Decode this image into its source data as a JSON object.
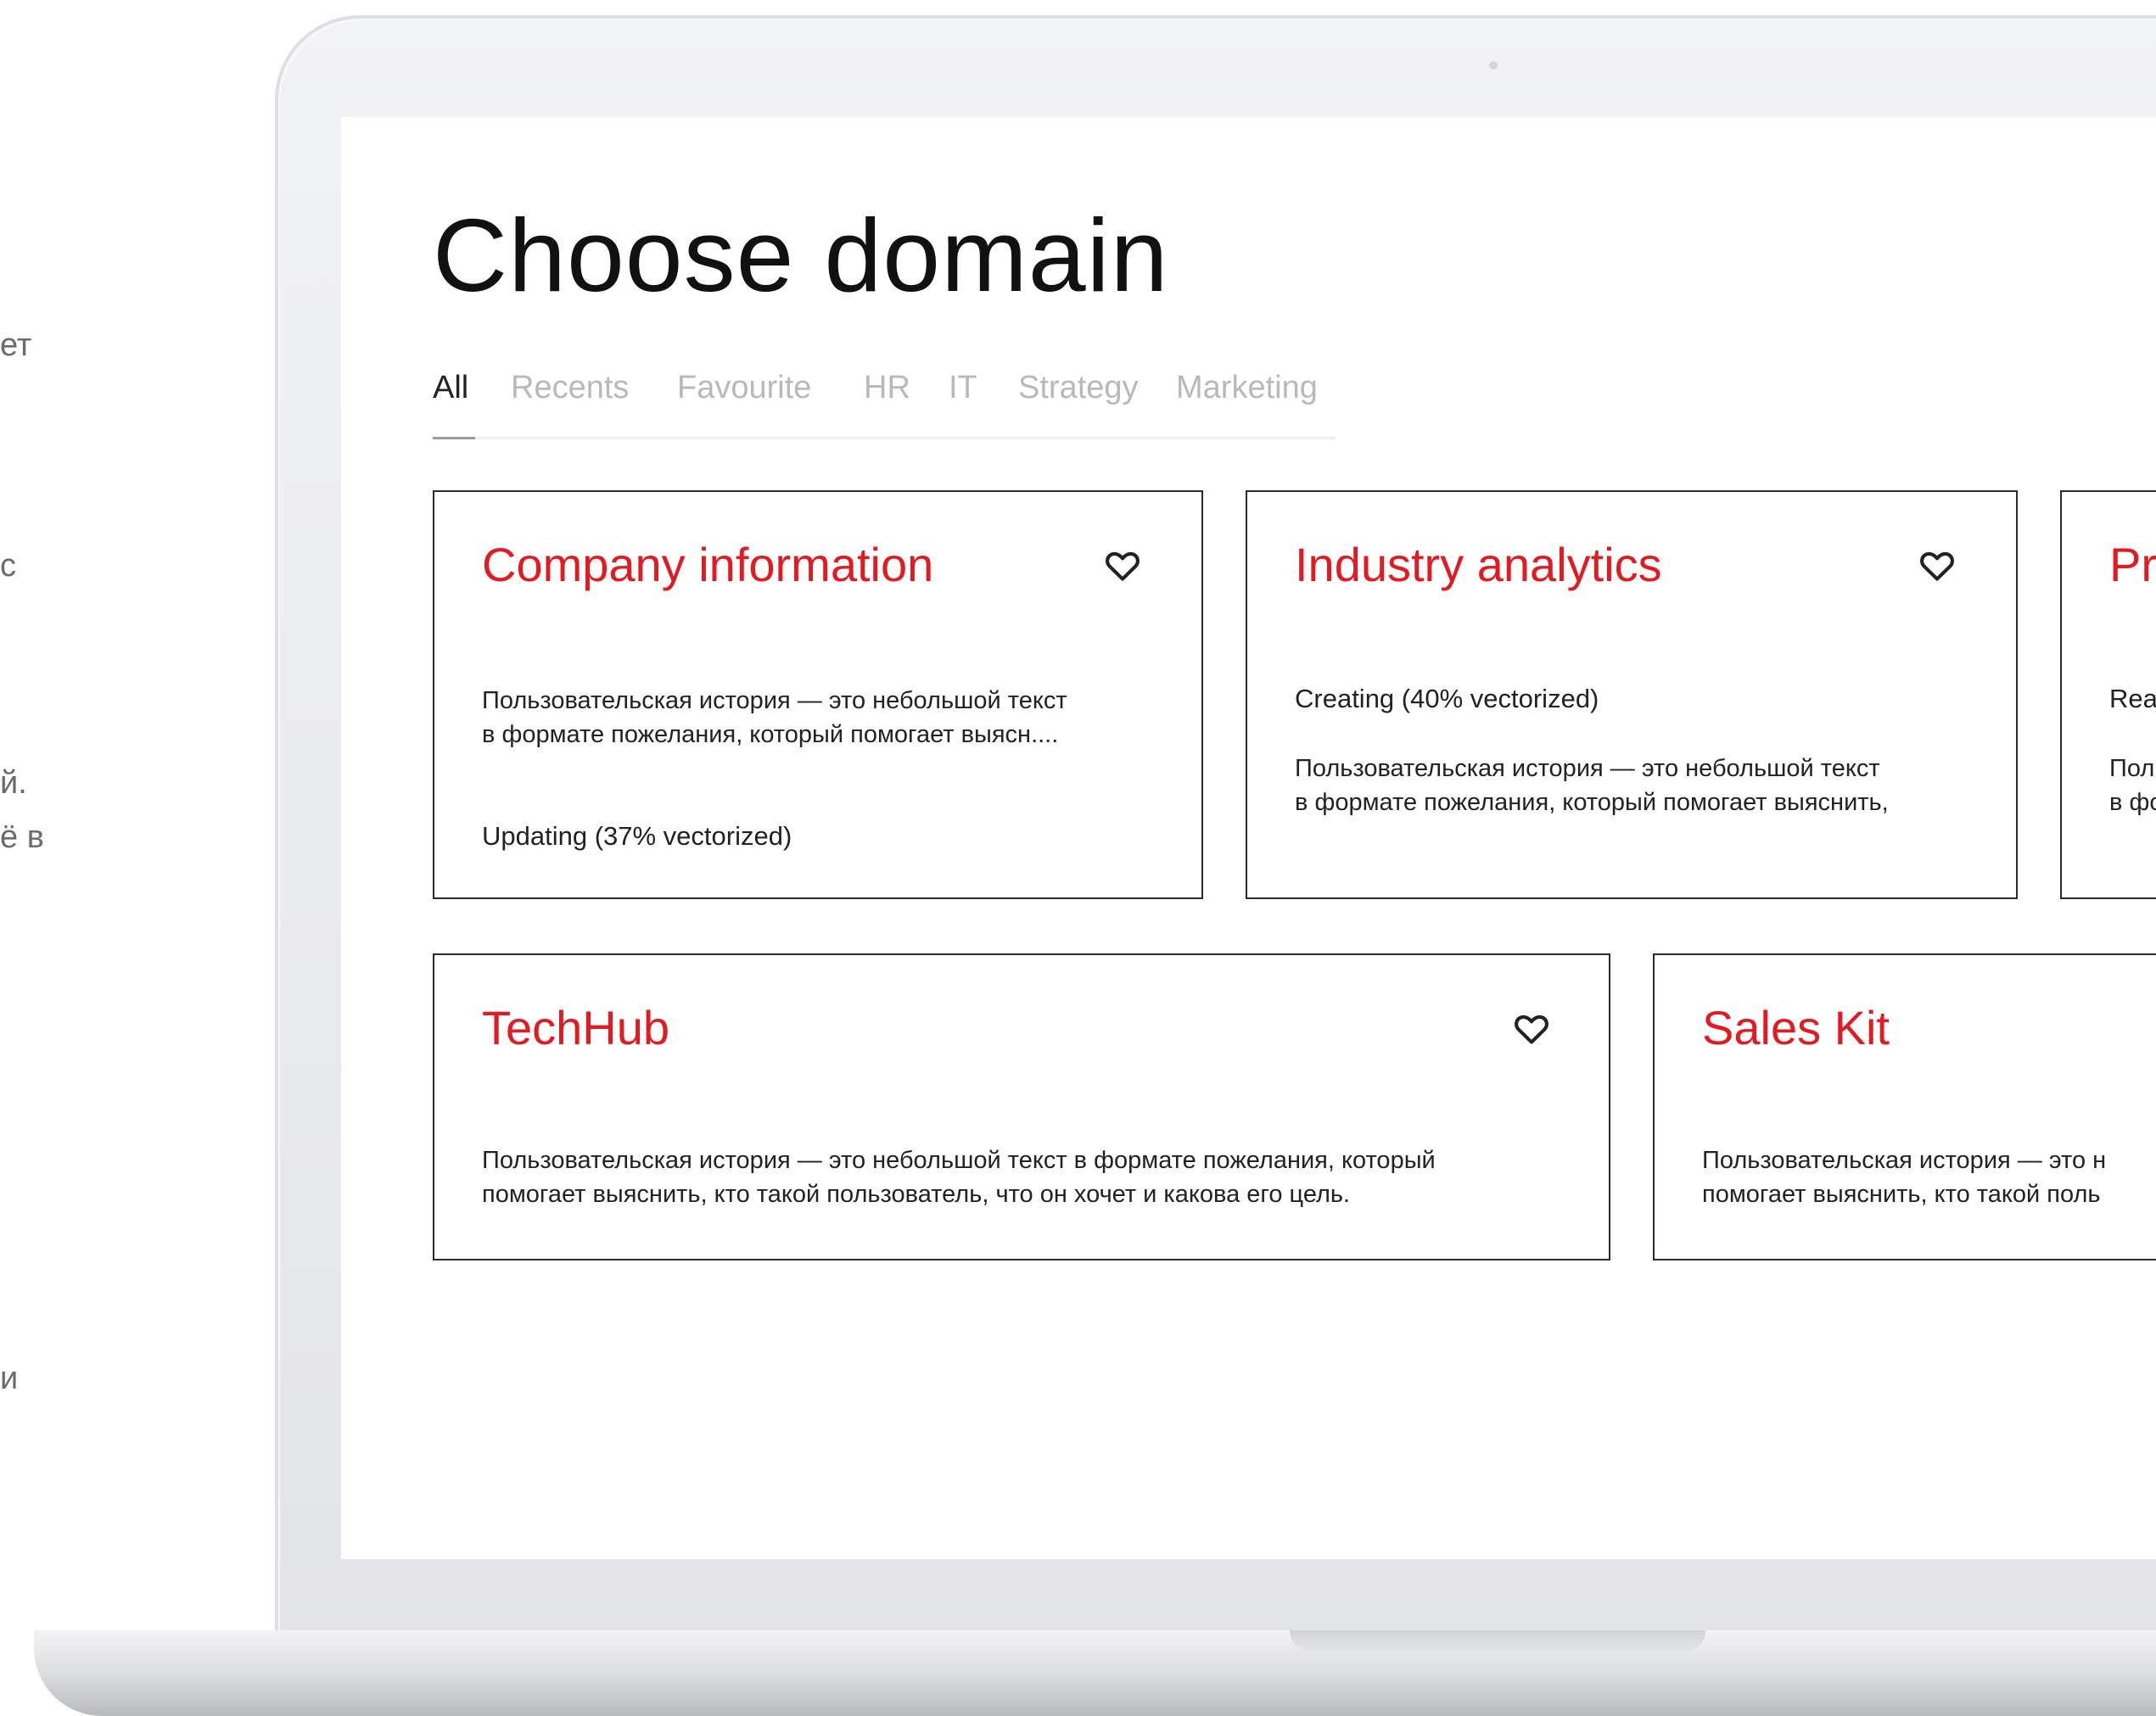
{
  "side_fragments": [
    "ет",
    "с",
    "й.",
    "ё в",
    "и"
  ],
  "page": {
    "title": "Choose domain"
  },
  "tabs": [
    {
      "label": "All",
      "active": true
    },
    {
      "label": "Recents",
      "active": false
    },
    {
      "label": "Favourite",
      "active": false
    },
    {
      "label": "HR",
      "active": false
    },
    {
      "label": "IT",
      "active": false
    },
    {
      "label": "Strategy",
      "active": false
    },
    {
      "label": "Marketing",
      "active": false
    }
  ],
  "cards": [
    {
      "title": "Company information",
      "description": [
        "Пользовательская история — это небольшой текст",
        "в формате пожелания, который помогает выясн...."
      ],
      "status": "Updating (37% vectorized)",
      "vectorized_percent": 37,
      "favourite_icon": "heart-outline-icon"
    },
    {
      "title": "Industry analytics",
      "status": "Creating (40% vectorized)",
      "vectorized_percent": 40,
      "description": [
        "Пользовательская история — это небольшой текст",
        "в формате пожелания, который помогает выяснить,"
      ],
      "favourite_icon": "heart-outline-icon"
    },
    {
      "title": "Pr",
      "status": "Rea",
      "description": [
        "Пол",
        "в фо"
      ]
    },
    {
      "title": "TechHub",
      "description": [
        "Пользовательская история — это небольшой текст в формате пожелания, который",
        "помогает выяснить, кто такой пользователь, что он хочет и какова его цель."
      ],
      "favourite_icon": "heart-outline-icon"
    },
    {
      "title": "Sales Kit",
      "description": [
        "Пользовательская история — это н",
        "помогает выяснить, кто такой поль"
      ]
    }
  ],
  "colors": {
    "accent": "#e21b23",
    "text": "#111111",
    "muted_tab": "#b9b9b9",
    "card_border": "#2b2b2b"
  }
}
